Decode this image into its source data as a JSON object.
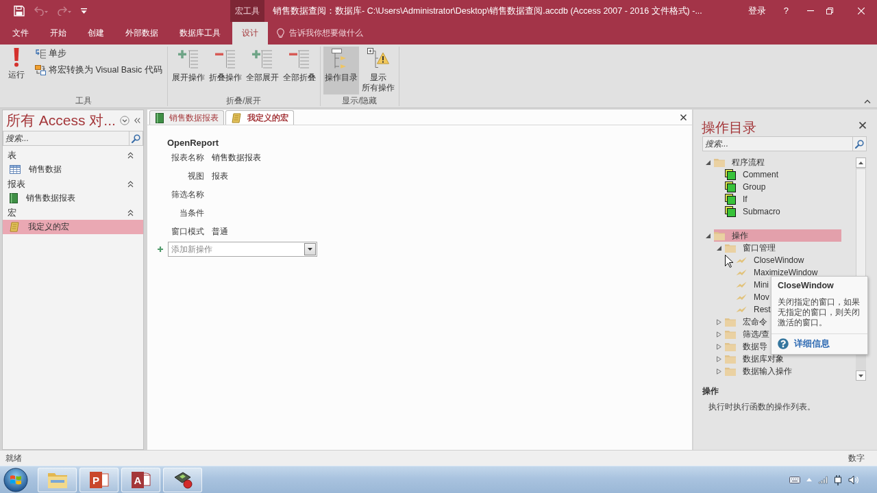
{
  "title_bar": {
    "quick_access": [
      {
        "kind": "save",
        "disabled": false
      },
      {
        "kind": "undo",
        "disabled": true
      },
      {
        "kind": "redo",
        "disabled": true
      },
      {
        "kind": "customize",
        "disabled": false
      }
    ],
    "context_tab": "宏工具",
    "title": "销售数据查阅：数据库- C:\\Users\\Administrator\\Desktop\\销售数据查阅.accdb (Access 2007 - 2016 文件格式) -...",
    "sign_in": "登录",
    "help": "?"
  },
  "ribbon_tabs": [
    {
      "label": "文件",
      "selected": false
    },
    {
      "label": "开始",
      "selected": false
    },
    {
      "label": "创建",
      "selected": false
    },
    {
      "label": "外部数据",
      "selected": false
    },
    {
      "label": "数据库工具",
      "selected": false
    },
    {
      "label": "设计",
      "selected": true
    }
  ],
  "tell_me": {
    "placeholder": "告诉我你想要做什么"
  },
  "ribbon_groups": [
    {
      "label": "工具",
      "buttons": [
        {
          "kind": "run",
          "label": "运行",
          "pressed": false
        },
        {
          "kind": "single_step",
          "label": "单步",
          "pressed": false
        },
        {
          "kind": "convert_to_vba",
          "label": "将宏转换为 Visual Basic 代码",
          "pressed": false
        }
      ]
    },
    {
      "label": "折叠/展开",
      "buttons": [
        {
          "kind": "expand",
          "label": "展开操作",
          "pressed": false
        },
        {
          "kind": "collapse",
          "label": "折叠操作",
          "pressed": false
        },
        {
          "kind": "expand_all",
          "label": "全部展开",
          "pressed": false
        },
        {
          "kind": "collapse_all",
          "label": "全部折叠",
          "pressed": false
        }
      ]
    },
    {
      "label": "显示/隐藏",
      "buttons": [
        {
          "kind": "action_catalog",
          "label": "操作目录",
          "pressed": true
        },
        {
          "kind": "show_all",
          "label_lines": [
            "显示",
            "所有操作"
          ],
          "pressed": false
        }
      ]
    }
  ],
  "nav_pane": {
    "title": "所有 Access 对...",
    "search": {
      "placeholder": "搜索..."
    },
    "groups": [
      {
        "label": "表",
        "expanded": true,
        "items": [
          {
            "kind": "table",
            "label": "销售数据",
            "selected": false
          }
        ]
      },
      {
        "label": "报表",
        "expanded": true,
        "items": [
          {
            "kind": "report",
            "label": "销售数据报表",
            "selected": false
          }
        ]
      },
      {
        "label": "宏",
        "expanded": true,
        "items": [
          {
            "kind": "macro",
            "label": "我定义的宏",
            "selected": true
          }
        ]
      }
    ]
  },
  "document_tabs": [
    {
      "kind": "report",
      "label": "销售数据报表",
      "selected": false
    },
    {
      "kind": "macro",
      "label": "我定义的宏",
      "selected": true
    }
  ],
  "macro": {
    "action": "OpenReport",
    "arguments": [
      {
        "label": "报表名称",
        "value": "销售数据报表"
      },
      {
        "label": "视图",
        "value": "报表"
      },
      {
        "label": "筛选名称"
      },
      {
        "label": "当条件"
      },
      {
        "label": "窗口模式",
        "value": "普通"
      }
    ],
    "add_action": {
      "placeholder": "添加新操作"
    }
  },
  "action_catalog": {
    "title": "操作目录",
    "search": {
      "placeholder": "搜索..."
    },
    "tree": [
      {
        "kind": "folder",
        "label": "程序流程",
        "expanded": true,
        "selected": false,
        "children": [
          {
            "kind": "flow",
            "label": "Comment",
            "selected": false
          },
          {
            "kind": "flow",
            "label": "Group",
            "selected": false
          },
          {
            "kind": "flow",
            "label": "If",
            "selected": false
          },
          {
            "kind": "flow",
            "label": "Submacro",
            "selected": false
          }
        ]
      },
      {
        "kind": "folder",
        "label": "操作",
        "expanded": true,
        "selected": true,
        "children": [
          {
            "kind": "folder",
            "label": "窗口管理",
            "expanded": true,
            "selected": false,
            "children": [
              {
                "kind": "action",
                "label": "CloseWindow",
                "selected": false
              },
              {
                "kind": "action",
                "label": "MaximizeWindow",
                "selected": false
              },
              {
                "kind": "action",
                "label": "Mini",
                "selected": false
              },
              {
                "kind": "action",
                "label": "Mov",
                "selected": false
              },
              {
                "kind": "action",
                "label": "Rest",
                "selected": false
              }
            ]
          },
          {
            "kind": "folder",
            "label": "宏命令",
            "expanded": false,
            "selected": false
          },
          {
            "kind": "folder",
            "label": "筛选/查",
            "expanded": false,
            "selected": false
          },
          {
            "kind": "folder",
            "label": "数据导",
            "expanded": false,
            "selected": false
          },
          {
            "kind": "folder",
            "label": "数据库对象",
            "expanded": false,
            "selected": false
          },
          {
            "kind": "folder",
            "label": "数据输入操作",
            "expanded": false,
            "selected": false
          }
        ]
      }
    ],
    "tooltip": {
      "title": "CloseWindow",
      "text": "关闭指定的窗口，如果无指定的窗口，则关闭激活的窗口。",
      "link": "详细信息"
    },
    "details": {
      "title": "操作",
      "text": "执行时执行函数的操作列表。"
    }
  },
  "status_bar": {
    "left": "就绪",
    "right": "数字"
  },
  "taskbar": {
    "apps": [
      {
        "kind": "file_explorer"
      },
      {
        "kind": "presentation",
        "glyph": "P"
      },
      {
        "kind": "database",
        "glyph": "A"
      },
      {
        "kind": "media"
      }
    ]
  }
}
